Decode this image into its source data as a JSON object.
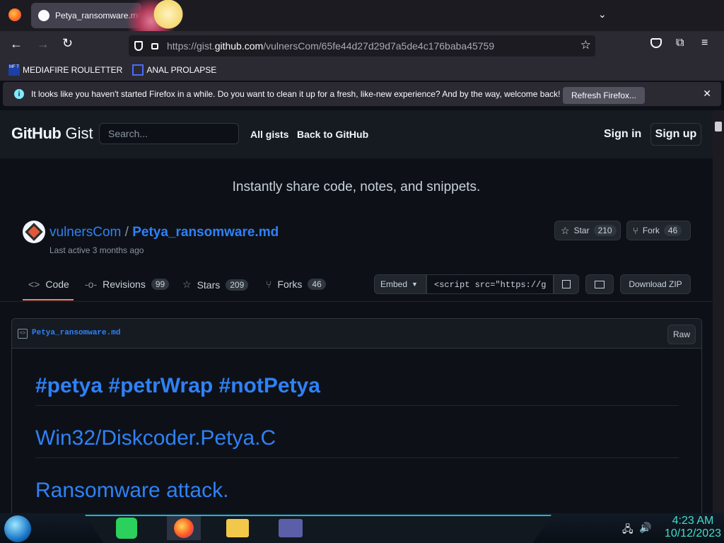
{
  "browser": {
    "tab_title": "Petya_ransomware.md",
    "url_prefix": "https://gist.",
    "url_domain": "github.com",
    "url_path": "/vulnersCom/65fe44d27d29d7a5de4c176baba45759",
    "bookmarks": [
      {
        "icon_text": "MF T",
        "label": "MEDIAFIRE ROULETTER"
      },
      {
        "label": "ANAL PROLAPSE"
      }
    ],
    "notification": {
      "text": "It looks like you haven't started Firefox in a while. Do you want to clean it up for a fresh, like-new experience? And by the way, welcome back!",
      "button": "Refresh Firefox..."
    }
  },
  "header": {
    "logo_github": "GitHub",
    "logo_gist": "Gist",
    "search_placeholder": "Search...",
    "nav": [
      "All gists",
      "Back to GitHub"
    ],
    "sign_in": "Sign in",
    "sign_up": "Sign up"
  },
  "hero": {
    "tagline": "Instantly share code, notes, and snippets."
  },
  "gist": {
    "owner": "vulnersCom",
    "separator": "/",
    "filename": "Petya_ransomware.md",
    "last_active": "Last active 3 months ago",
    "star_label": "Star",
    "star_count": "210",
    "fork_label": "Fork",
    "fork_count": "46"
  },
  "tabs": [
    {
      "label": "Code"
    },
    {
      "label": "Revisions",
      "count": "99"
    },
    {
      "label": "Stars",
      "count": "209"
    },
    {
      "label": "Forks",
      "count": "46"
    }
  ],
  "embed": {
    "label": "Embed",
    "value": "<script src=\"https://g",
    "download": "Download ZIP"
  },
  "file": {
    "name": "Petya_ransomware.md",
    "raw": "Raw",
    "headings": [
      "#petya #petrWrap #notPetya",
      "Win32/Diskcoder.Petya.C",
      "Ransomware attack."
    ]
  },
  "taskbar": {
    "time": "4:23 AM",
    "date": "10/12/2023"
  },
  "colors": {
    "link": "#2f81f7",
    "bg": "#0d1117",
    "accent": "#18b8d8"
  }
}
